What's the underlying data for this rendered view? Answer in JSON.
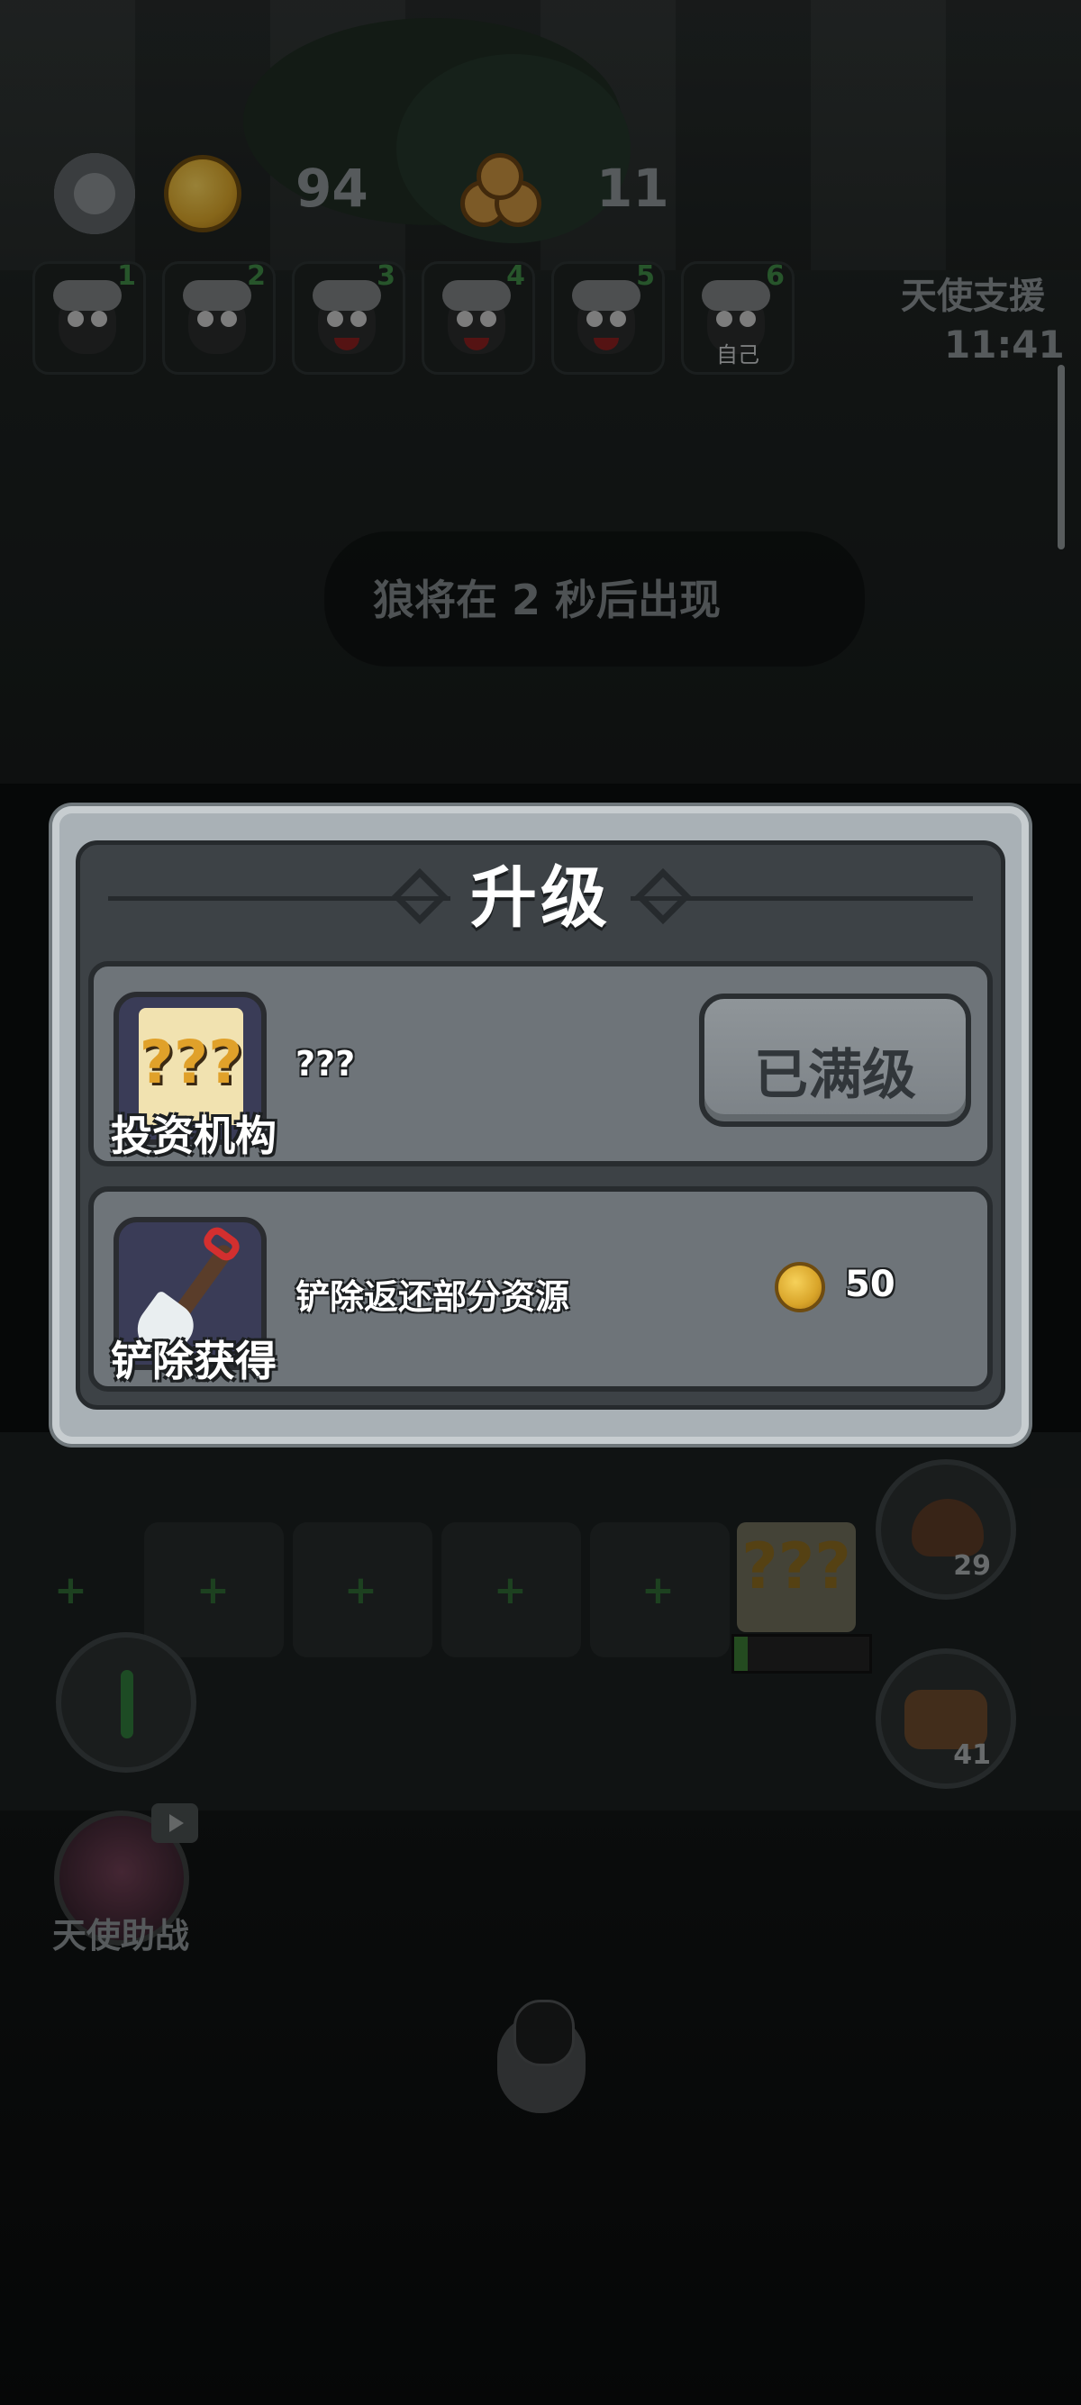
{
  "hud": {
    "coins": "94",
    "wood": "11",
    "players": [
      {
        "rank": "1",
        "label": ""
      },
      {
        "rank": "2",
        "label": ""
      },
      {
        "rank": "3",
        "label": ""
      },
      {
        "rank": "4",
        "label": ""
      },
      {
        "rank": "5",
        "label": ""
      },
      {
        "rank": "6",
        "label": "自己"
      }
    ],
    "angel_support": {
      "label": "天使支援",
      "timer": "11:41"
    }
  },
  "wolf_warning": "狼将在 2 秒后出现",
  "side_buttons": {
    "poop_count": "29",
    "boots_count": "41",
    "angel_help_label": "天使助战"
  },
  "plot": {
    "question_mark": "???",
    "progress": 0.1
  },
  "upgrade_modal": {
    "title": "升级",
    "rows": [
      {
        "icon": "question-paper-icon",
        "icon_label": "投资机构",
        "description": "???",
        "button_label": "已满级"
      },
      {
        "icon": "shovel-icon",
        "icon_label": "铲除获得",
        "description": "铲除返还部分资源",
        "cost": "50",
        "cost_icon": "coin-icon"
      }
    ]
  },
  "colors": {
    "panel_frame": "#a9b1b6",
    "panel_inner": "#3d4246",
    "row_bg": "#6e7479",
    "coin_gold": "#d9a52a",
    "shovel_red": "#d32f2f"
  }
}
